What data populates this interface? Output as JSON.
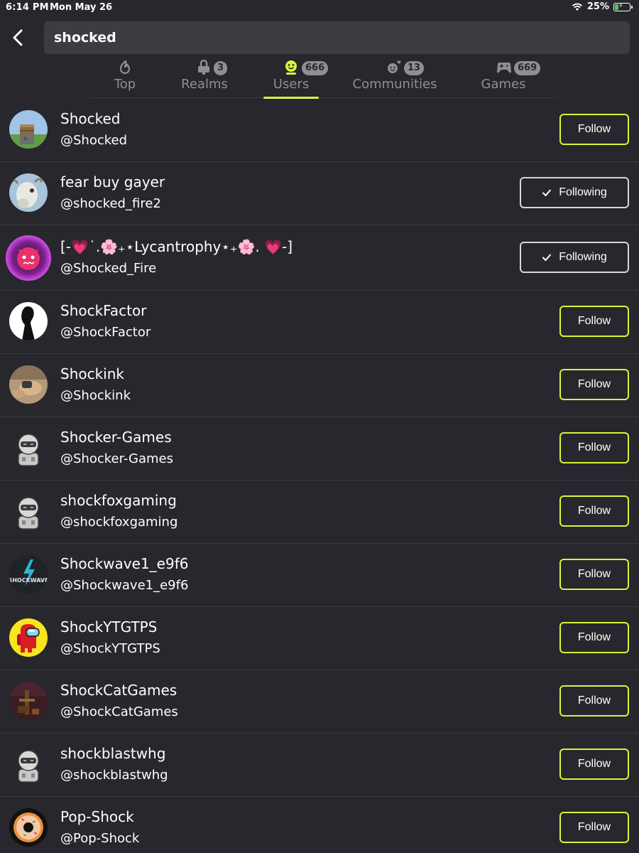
{
  "status_bar": {
    "time": "6:14 PM",
    "date": "Mon May 26",
    "battery": "25%",
    "battery_level": 0.25
  },
  "search": {
    "value": "shocked"
  },
  "tabs": [
    {
      "label": "Top",
      "badge": "",
      "icon": "flame-icon"
    },
    {
      "label": "Realms",
      "badge": "3",
      "icon": "realms-icon"
    },
    {
      "label": "Users",
      "badge": "666",
      "icon": "user-face-icon",
      "active": true
    },
    {
      "label": "Communities",
      "badge": "13",
      "icon": "community-icon"
    },
    {
      "label": "Games",
      "badge": "669",
      "icon": "gamepad-icon"
    }
  ],
  "users": [
    {
      "name": "Shocked",
      "handle": "@Shocked",
      "button": "Follow",
      "avatar": "minecraft-block"
    },
    {
      "name": "fear buy gayer",
      "handle": "@shocked_fire2",
      "button": "Following",
      "avatar": "goat"
    },
    {
      "name": "[-💗˙.🌸₊⋆Lycantrophy⋆₊🌸. 💗-]",
      "handle": "@Shocked_Fire",
      "button": "Following",
      "avatar": "purple-demon"
    },
    {
      "name": "ShockFactor",
      "handle": "@ShockFactor",
      "button": "Follow",
      "avatar": "silhouette"
    },
    {
      "name": "Shockink",
      "handle": "@Shockink",
      "button": "Follow",
      "avatar": "hand-photo"
    },
    {
      "name": "Shocker-Games",
      "handle": "@Shocker-Games",
      "button": "Follow",
      "avatar": "default-robot"
    },
    {
      "name": "shockfoxgaming",
      "handle": "@shockfoxgaming",
      "button": "Follow",
      "avatar": "default-robot"
    },
    {
      "name": "Shockwave1_e9f6",
      "handle": "@Shockwave1_e9f6",
      "button": "Follow",
      "avatar": "shockwave-logo",
      "avatar_text": "SHOCKWAVE"
    },
    {
      "name": "ShockYTGTPS",
      "handle": "@ShockYTGTPS",
      "button": "Follow",
      "avatar": "among-us"
    },
    {
      "name": "ShockCatGames",
      "handle": "@ShockCatGames",
      "button": "Follow",
      "avatar": "dark-scene"
    },
    {
      "name": "shockblastwhg",
      "handle": "@shockblastwhg",
      "button": "Follow",
      "avatar": "default-robot"
    },
    {
      "name": "Pop-Shock",
      "handle": "@Pop-Shock",
      "button": "Follow",
      "avatar": "donut"
    }
  ],
  "colors": {
    "background": "#28272d",
    "accent": "#d7f53a",
    "muted": "#8f8e95",
    "divider": "#3c3b42",
    "search_bg": "#3d3c43"
  }
}
